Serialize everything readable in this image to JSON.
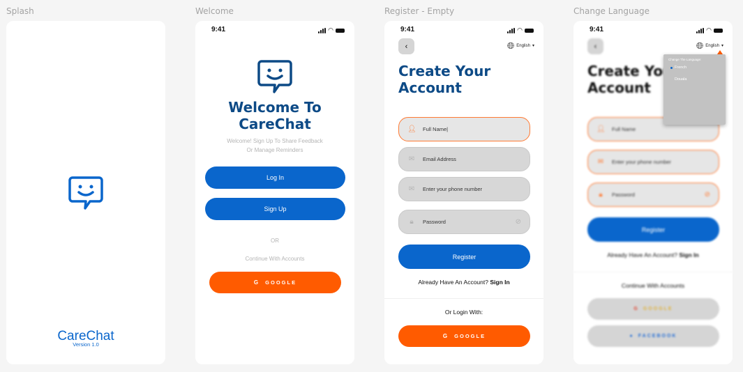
{
  "frames": {
    "splash": "Splash",
    "welcome": "Welcome",
    "register": "Register - Empty",
    "change_lang": "Change Language"
  },
  "status": {
    "time": "9:41"
  },
  "splash": {
    "app_name": "CareChat",
    "version": "Version 1.0"
  },
  "welcome": {
    "title_line1": "Welcome To",
    "title_line2": "CareChat",
    "subtitle_line1": "Welcome! Sign Up To Share Feedback",
    "subtitle_line2": "Or Manage Reminders",
    "login": "Log In",
    "signup": "Sign Up",
    "or": "OR",
    "continue": "Continue With Accounts",
    "google": "GOOGLE"
  },
  "register": {
    "language": "English",
    "title_line1": "Create Your",
    "title_line2": "Account",
    "full_name": "Full Name|",
    "email": "Email Address",
    "phone": "Enter your phone number",
    "password": "Password",
    "register": "Register",
    "have_account": "Already Have An Account?",
    "sign_in": "Sign In",
    "or_login": "Or Login With:",
    "google": "GOOGLE"
  },
  "change_lang": {
    "language": "English",
    "title_line1": "Create Your",
    "title_line2": "Account",
    "full_name": "Full Name",
    "phone": "Enter your phone number",
    "password": "Password",
    "register": "Register",
    "have_account": "Already Have An Account?",
    "sign_in": "Sign In",
    "continue": "Continue With Accounts",
    "google": "GOOGLE",
    "facebook": "FACEBOOK",
    "dropdown_title": "Change The Language:",
    "options": [
      "French",
      "Douala"
    ],
    "selected": "French"
  },
  "colors": {
    "brand_blue": "#0a66cc",
    "brand_orange": "#ff5b00",
    "title_navy": "#0d4a86"
  }
}
